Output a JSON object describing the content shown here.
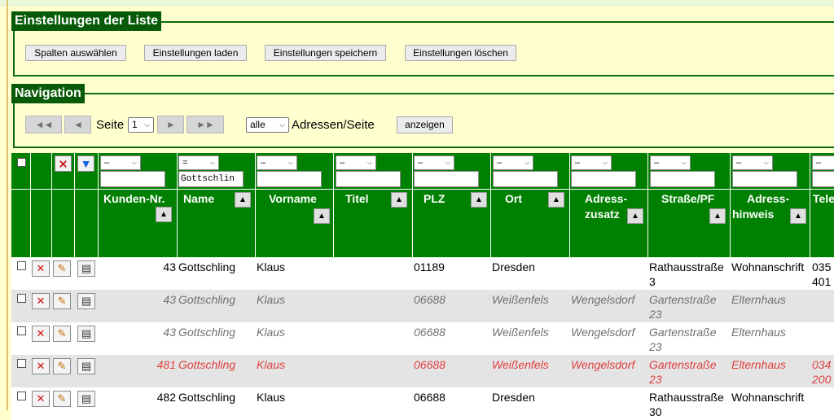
{
  "settings": {
    "legend": "Einstellungen der Liste",
    "buttons": [
      "Spalten auswählen",
      "Einstellungen laden",
      "Einstellungen speichern",
      "Einstellungen löschen"
    ]
  },
  "navigation": {
    "legend": "Navigation",
    "first": "◄◄",
    "prev": "◄",
    "next": "►",
    "last": "►►",
    "page_label": "Seite",
    "page_value": "1",
    "per_page_value": "alle",
    "per_page_label": "Adressen/Seite",
    "show_button": "anzeigen"
  },
  "filters": {
    "operators": [
      "–",
      "=",
      "–",
      "–",
      "–",
      "–",
      "–",
      "–",
      "–",
      "–",
      "–"
    ],
    "name_value": "Gottschlin"
  },
  "columns": [
    {
      "label": "Kunden-Nr.",
      "label2": ""
    },
    {
      "label": "Name",
      "label2": ""
    },
    {
      "label": "Vorname",
      "label2": ""
    },
    {
      "label": "Titel",
      "label2": ""
    },
    {
      "label": "PLZ",
      "label2": ""
    },
    {
      "label": "Ort",
      "label2": ""
    },
    {
      "label": "Adress-",
      "label2": "zusatz"
    },
    {
      "label": "Straße/PF",
      "label2": ""
    },
    {
      "label": "Adress-",
      "label2": "hinweis"
    },
    {
      "label": "Tele",
      "label2": ""
    }
  ],
  "icons": {
    "clear_filter": "filter-clear-icon",
    "apply_filter": "filter-icon",
    "delete": "delete-icon",
    "edit": "edit-icon",
    "details": "details-icon",
    "sort": "sort-up-icon"
  },
  "colors": {
    "header_green": "#008000",
    "legend_green": "#075a07",
    "panel_bg": "#ffffd0",
    "muted_text": "#707070",
    "highlight_red": "#e04040"
  },
  "rows": [
    {
      "style": "norm",
      "kunden_nr": "43",
      "name": "Gottschling",
      "vorname": "Klaus",
      "titel": "",
      "plz": "01189",
      "ort": "Dresden",
      "adresszusatz": "",
      "strasse1": "Rathausstraße",
      "strasse2": "3",
      "hinweis": "Wohnanschrift",
      "tel1": "035",
      "tel2": "401"
    },
    {
      "style": "it",
      "kunden_nr": "43",
      "name": "Gottschling",
      "vorname": "Klaus",
      "titel": "",
      "plz": "06688",
      "ort": "Weißenfels",
      "adresszusatz": "Wengelsdorf",
      "strasse1": "Gartenstraße",
      "strasse2": "23",
      "hinweis": "Elternhaus",
      "tel1": "",
      "tel2": ""
    },
    {
      "style": "it",
      "kunden_nr": "43",
      "name": "Gottschling",
      "vorname": "Klaus",
      "titel": "",
      "plz": "06688",
      "ort": "Weißenfels",
      "adresszusatz": "Wengelsdorf",
      "strasse1": "Gartenstraße",
      "strasse2": "23",
      "hinweis": "Elternhaus",
      "tel1": "",
      "tel2": ""
    },
    {
      "style": "red",
      "kunden_nr": "481",
      "name": "Gottschling",
      "vorname": "Klaus",
      "titel": "",
      "plz": "06688",
      "ort": "Weißenfels",
      "adresszusatz": "Wengelsdorf",
      "strasse1": "Gartenstraße",
      "strasse2": "23",
      "hinweis": "Elternhaus",
      "tel1": "034",
      "tel2": "200"
    },
    {
      "style": "norm",
      "kunden_nr": "482",
      "name": "Gottschling",
      "vorname": "Klaus",
      "titel": "",
      "plz": "06688",
      "ort": "Dresden",
      "adresszusatz": "",
      "strasse1": "Rathausstraße",
      "strasse2": "30",
      "hinweis": "Wohnanschrift",
      "tel1": "",
      "tel2": ""
    }
  ]
}
